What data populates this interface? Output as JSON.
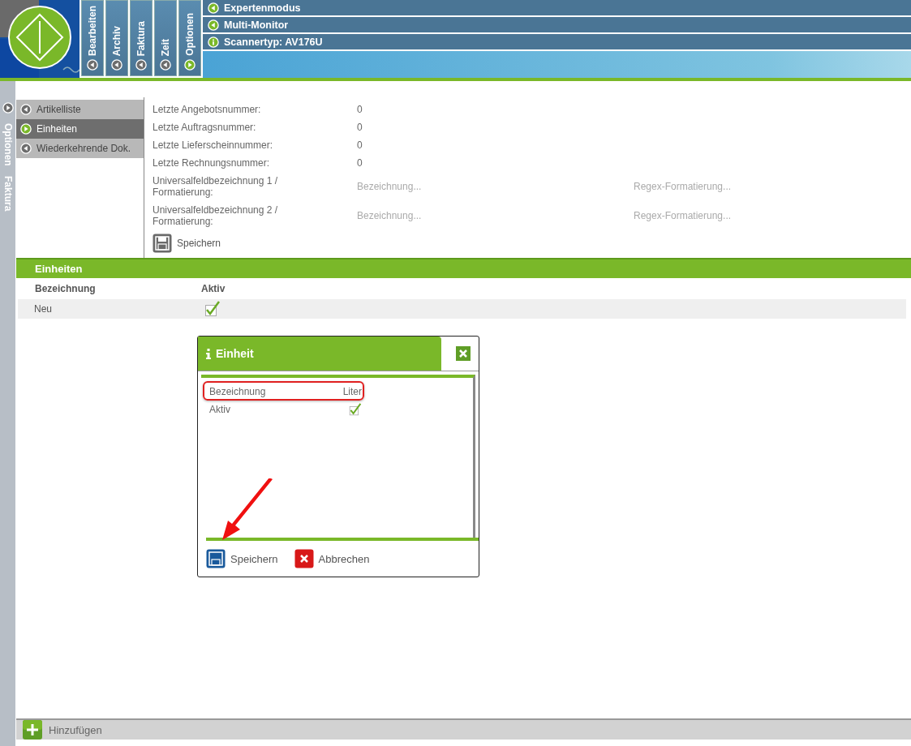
{
  "main_tabs": [
    {
      "label": "Bearbeiten",
      "selected": false
    },
    {
      "label": "Archiv",
      "selected": false
    },
    {
      "label": "Faktura",
      "selected": false
    },
    {
      "label": "Zeit",
      "selected": false
    },
    {
      "label": "Optionen",
      "selected": true
    }
  ],
  "toolbar_items": [
    {
      "label": "Expertenmodus",
      "kind": "toggle"
    },
    {
      "label": "Multi-Monitor",
      "kind": "toggle"
    },
    {
      "label": "Scannertyp: AV176U",
      "kind": "info"
    }
  ],
  "side_tabs": [
    "Optionen",
    "Faktura"
  ],
  "nav": [
    {
      "label": "Artikelliste",
      "selected": false
    },
    {
      "label": "Einheiten",
      "selected": true
    },
    {
      "label": "Wiederkehrende Dok.",
      "selected": false
    }
  ],
  "settings": {
    "fields": [
      {
        "label": "Letzte Angebotsnummer:",
        "kind": "value",
        "value": "0"
      },
      {
        "label": "Letzte Auftragsnummer:",
        "kind": "value",
        "value": "0"
      },
      {
        "label": "Letzte Lieferscheinnummer:",
        "kind": "value",
        "value": "0"
      },
      {
        "label": "Letzte Rechnungsnummer:",
        "kind": "value",
        "value": "0"
      },
      {
        "label": "Universalfeldbezeichnung 1 / Formatierung:",
        "kind": "inputs",
        "placeholders": [
          "Bezeichnung...",
          "Regex-Formatierung..."
        ]
      },
      {
        "label": "Universalfeldbezeichnung 2 / Formatierung:",
        "kind": "inputs",
        "placeholders": [
          "Bezeichnung...",
          "Regex-Formatierung..."
        ]
      }
    ],
    "save_button": "Speichern"
  },
  "units_panel": {
    "title": "Einheiten",
    "columns": [
      "Bezeichnung",
      "Aktiv"
    ],
    "rows": [
      {
        "name": "Neu",
        "active": true
      }
    ]
  },
  "dialog": {
    "title": "Einheit",
    "fields": [
      {
        "label": "Bezeichnung",
        "kind": "text",
        "value": "Liter"
      },
      {
        "label": "Aktiv",
        "kind": "checkbox",
        "checked": true
      }
    ],
    "buttons": [
      {
        "label": "Speichern",
        "kind": "save"
      },
      {
        "label": "Abbrechen",
        "kind": "cancel"
      }
    ]
  },
  "add_button": "Hinzufügen"
}
